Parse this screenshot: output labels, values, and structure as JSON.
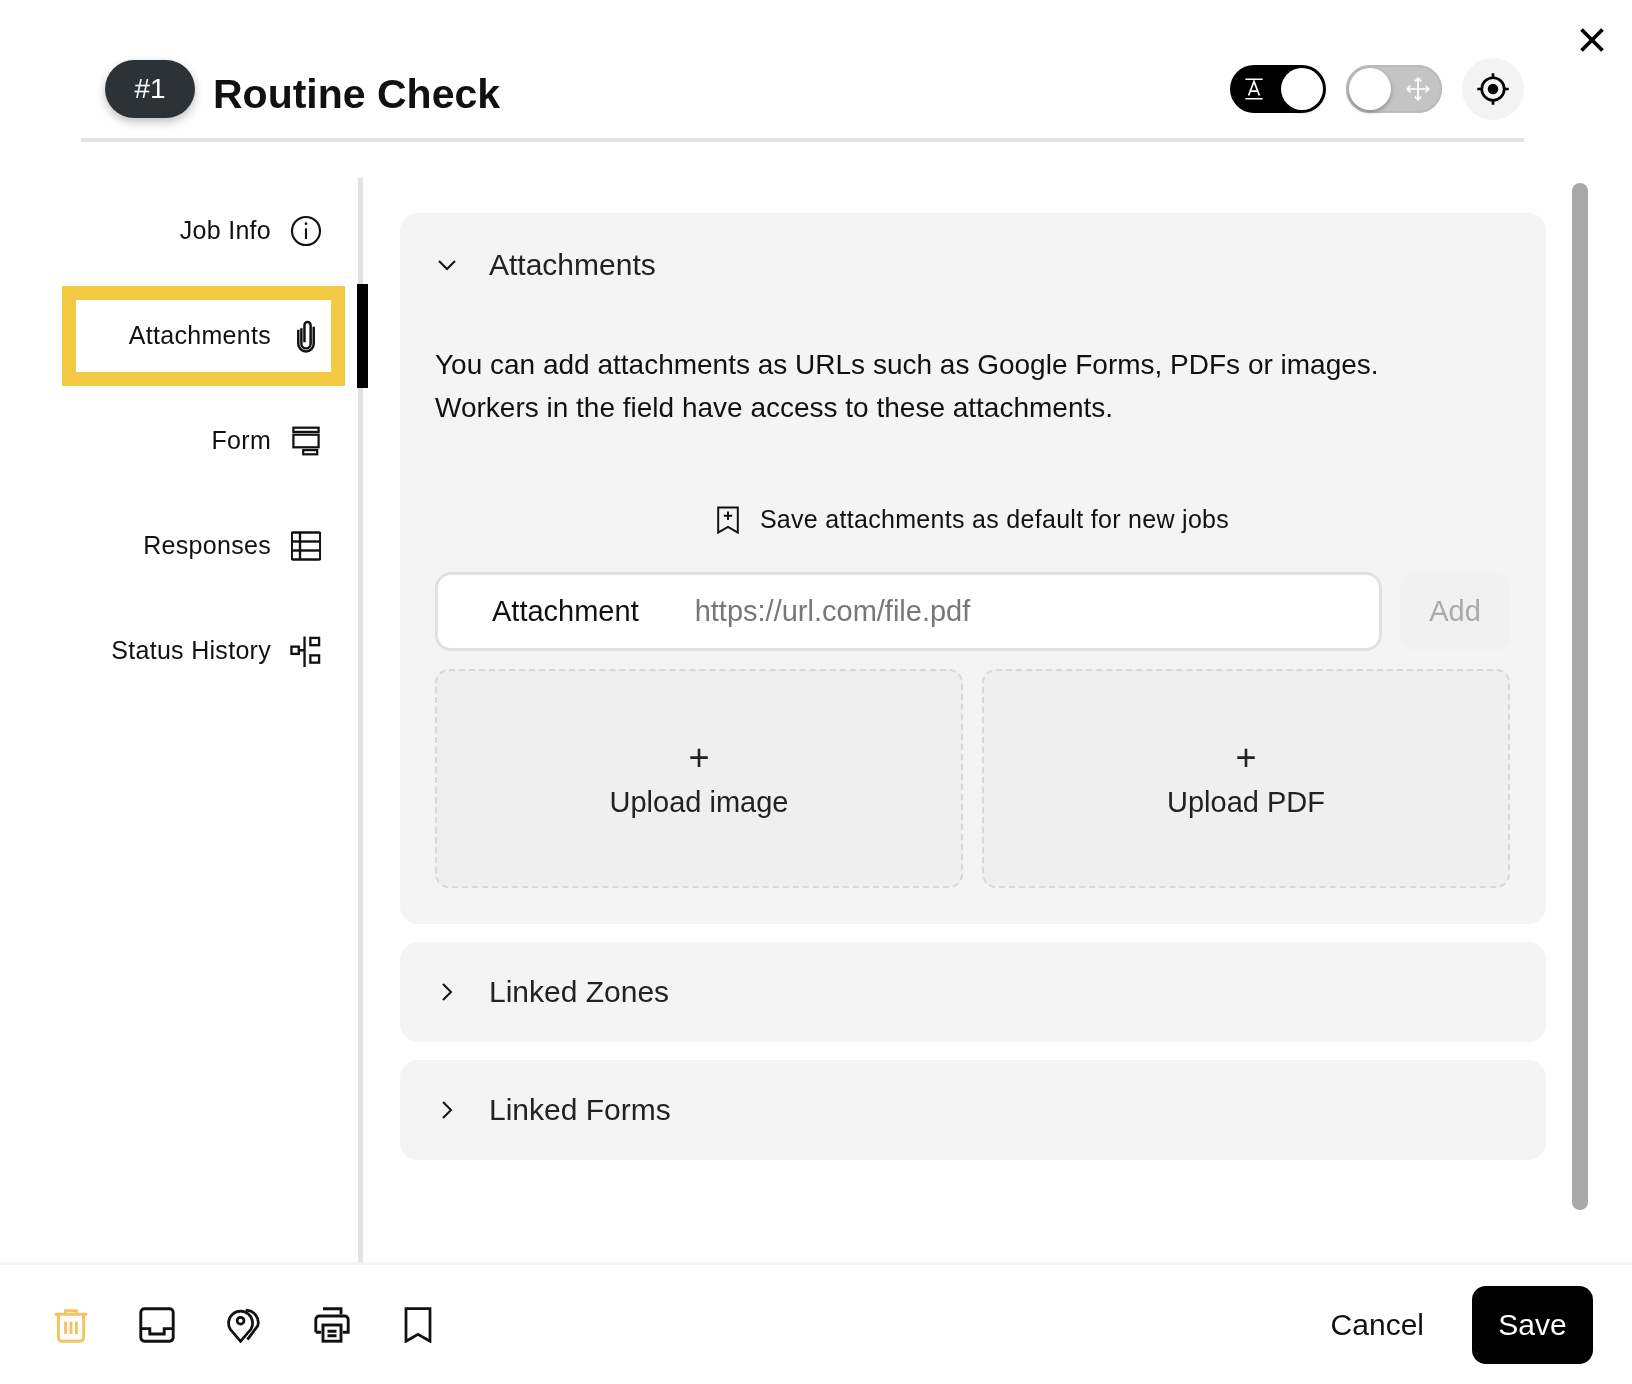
{
  "header": {
    "badge": "#1",
    "title": "Routine Check",
    "toggles": [
      {
        "kind": "text",
        "on": true
      },
      {
        "kind": "move",
        "on": false
      }
    ]
  },
  "sidebar": {
    "items": [
      {
        "label": "Job Info",
        "kind": "info",
        "selected": false
      },
      {
        "label": "Attachments",
        "kind": "paperclip",
        "selected": true
      },
      {
        "label": "Form",
        "kind": "form",
        "selected": false
      },
      {
        "label": "Responses",
        "kind": "table",
        "selected": false
      },
      {
        "label": "Status History",
        "kind": "tree",
        "selected": false
      }
    ]
  },
  "sections": [
    {
      "title": "Attachments",
      "expanded": true,
      "description": "You can add attachments as URLs such as Google Forms, PDFs or images. Workers in the field have access to these attachments.",
      "save_default": "Save attachments as default for new jobs",
      "input": {
        "label": "Attachment",
        "placeholder": "https://url.com/file.pdf"
      },
      "add_button": "Add",
      "uploads": [
        {
          "plus": "+",
          "label": "Upload image"
        },
        {
          "plus": "+",
          "label": "Upload PDF"
        }
      ]
    },
    {
      "title": "Linked Zones",
      "expanded": false
    },
    {
      "title": "Linked Forms",
      "expanded": false
    }
  ],
  "footer": {
    "tools": [
      {
        "kind": "trash"
      },
      {
        "kind": "inbox"
      },
      {
        "kind": "pins"
      },
      {
        "kind": "printer"
      },
      {
        "kind": "bookmark"
      }
    ],
    "cancel": "Cancel",
    "save": "Save"
  }
}
